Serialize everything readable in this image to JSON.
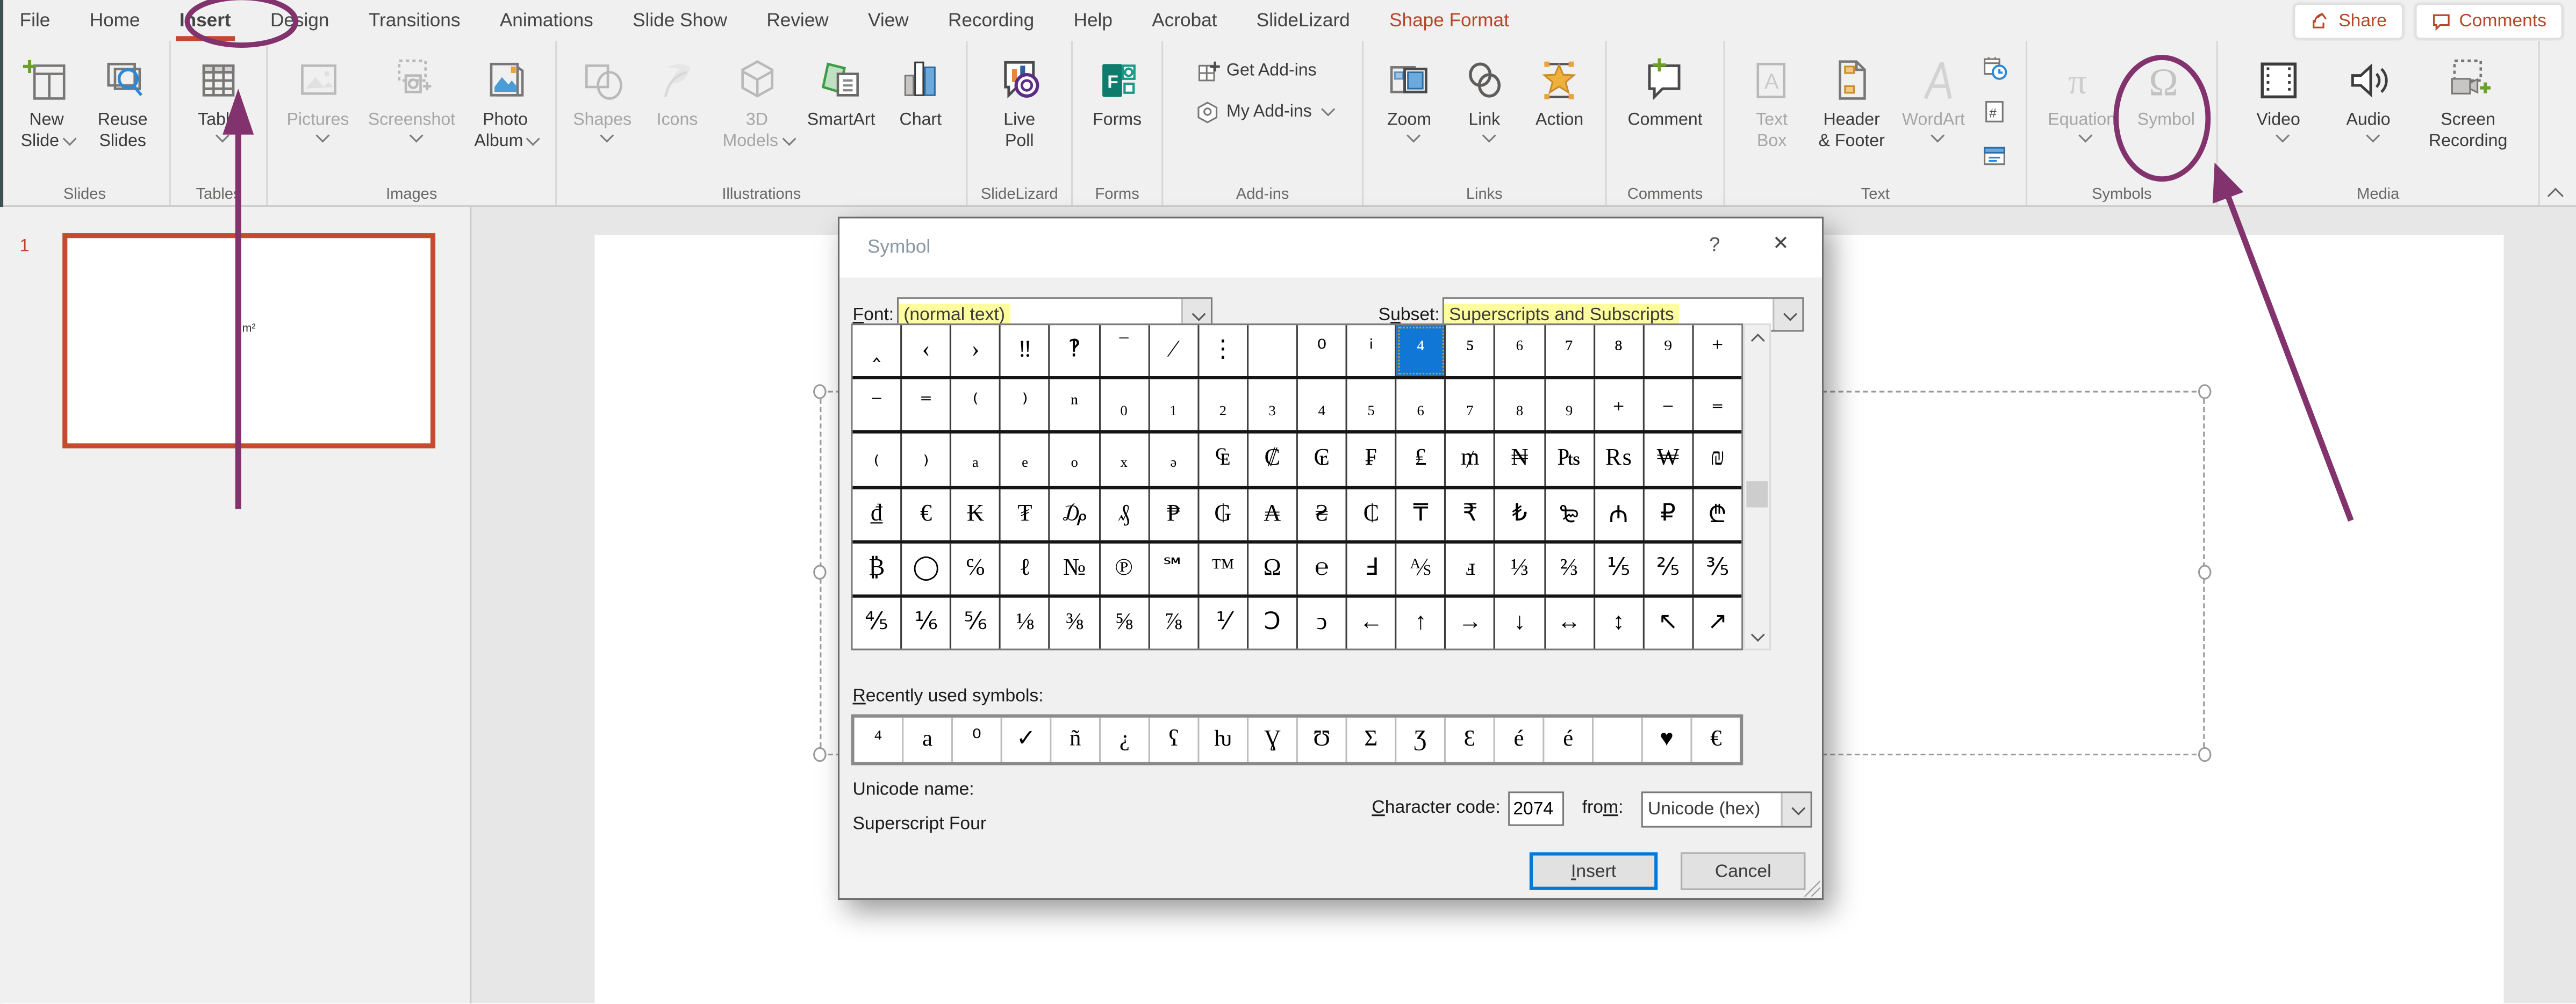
{
  "menu": {
    "tabs": [
      {
        "label": "File"
      },
      {
        "label": "Home"
      },
      {
        "label": "Insert",
        "selected": true
      },
      {
        "label": "Design"
      },
      {
        "label": "Transitions"
      },
      {
        "label": "Animations"
      },
      {
        "label": "Slide Show"
      },
      {
        "label": "Review"
      },
      {
        "label": "View"
      },
      {
        "label": "Recording"
      },
      {
        "label": "Help"
      },
      {
        "label": "Acrobat"
      },
      {
        "label": "SlideLizard"
      },
      {
        "label": "Shape Format",
        "accent": true
      }
    ],
    "share_label": "Share",
    "comments_label": "Comments"
  },
  "ribbon": {
    "groups": [
      {
        "label": "Slides",
        "buttons": [
          {
            "icon": "new-slide",
            "lines": [
              "New",
              "Slide"
            ],
            "chev_inline": true
          },
          {
            "icon": "reuse-slides",
            "lines": [
              "Reuse",
              "Slides"
            ]
          }
        ]
      },
      {
        "label": "Tables",
        "buttons": [
          {
            "icon": "table",
            "lines": [
              "Table"
            ],
            "chev_below": true
          }
        ]
      },
      {
        "label": "Images",
        "buttons": [
          {
            "icon": "pictures",
            "lines": [
              "Pictures"
            ],
            "chev_below": true,
            "disabled": true
          },
          {
            "icon": "screenshot",
            "lines": [
              "Screenshot"
            ],
            "chev_below": true,
            "disabled": true
          },
          {
            "icon": "photo-album",
            "lines": [
              "Photo",
              "Album"
            ],
            "chev_inline": true
          }
        ]
      },
      {
        "label": "Illustrations",
        "buttons": [
          {
            "icon": "shapes",
            "lines": [
              "Shapes"
            ],
            "chev_below": true,
            "disabled": true
          },
          {
            "icon": "icons",
            "lines": [
              "Icons"
            ],
            "disabled": true
          },
          {
            "icon": "3d-models",
            "lines": [
              "3D",
              "Models"
            ],
            "chev_inline": true,
            "disabled": true
          },
          {
            "icon": "smartart",
            "lines": [
              "SmartArt"
            ]
          },
          {
            "icon": "chart",
            "lines": [
              "Chart"
            ]
          }
        ]
      },
      {
        "label": "SlideLizard",
        "buttons": [
          {
            "icon": "live-poll",
            "lines": [
              "Live",
              "Poll"
            ]
          }
        ]
      },
      {
        "label": "Forms",
        "buttons": [
          {
            "icon": "forms",
            "lines": [
              "Forms"
            ]
          }
        ]
      },
      {
        "label": "Add-ins",
        "small_buttons": [
          {
            "icon": "get-addins",
            "label": "Get Add-ins"
          },
          {
            "icon": "my-addins",
            "label": "My Add-ins",
            "chev": true
          }
        ]
      },
      {
        "label": "Links",
        "buttons": [
          {
            "icon": "zoom",
            "lines": [
              "Zoom"
            ],
            "chev_below": true
          },
          {
            "icon": "link",
            "lines": [
              "Link"
            ],
            "chev_below": true
          },
          {
            "icon": "action",
            "lines": [
              "Action"
            ]
          }
        ]
      },
      {
        "label": "Comments",
        "buttons": [
          {
            "icon": "comment",
            "lines": [
              "Comment"
            ]
          }
        ]
      },
      {
        "label": "Text",
        "buttons": [
          {
            "icon": "text-box",
            "lines": [
              "Text",
              "Box"
            ],
            "disabled": true
          },
          {
            "icon": "header-footer",
            "lines": [
              "Header",
              "& Footer"
            ]
          },
          {
            "icon": "wordart",
            "lines": [
              "WordArt"
            ],
            "chev_below": true,
            "disabled": true
          }
        ],
        "stack_icons": [
          "date-time",
          "slide-number",
          "object"
        ]
      },
      {
        "label": "Symbols",
        "buttons": [
          {
            "icon": "equation",
            "lines": [
              "Equation"
            ],
            "chev_below": true,
            "disabled": true
          },
          {
            "icon": "symbol-omega",
            "lines": [
              "Symbol"
            ],
            "disabled": true
          }
        ]
      },
      {
        "label": "Media",
        "buttons": [
          {
            "icon": "video",
            "lines": [
              "Video"
            ],
            "chev_below": true
          },
          {
            "icon": "audio",
            "lines": [
              "Audio"
            ],
            "chev_below": true
          },
          {
            "icon": "screen-recording",
            "lines": [
              "Screen",
              "Recording"
            ]
          }
        ]
      }
    ]
  },
  "slides_panel": {
    "slide_number": "1",
    "slide_text": "m²"
  },
  "dialog": {
    "title": "Symbol",
    "help_icon": "?",
    "close_icon": "✕",
    "font_label": {
      "pre": "",
      "u": "F",
      "post": "ont:"
    },
    "font_value": "(normal text)",
    "subset_label": {
      "pre": "S",
      "u": "u",
      "post": "bset:"
    },
    "subset_value": "Superscripts and Subscripts",
    "grid": {
      "selected": {
        "row": 0,
        "col": 11
      },
      "rows": [
        [
          "‸",
          "‹",
          "›",
          "‼",
          "‽",
          "‾",
          "⁄",
          "⋮",
          "",
          "⁰",
          "ⁱ",
          "⁴",
          "⁵",
          "⁶",
          "⁷",
          "⁸",
          "⁹",
          "⁺"
        ],
        [
          "⁻",
          "⁼",
          "⁽",
          "⁾",
          "ⁿ",
          "₀",
          "₁",
          "₂",
          "₃",
          "₄",
          "₅",
          "₆",
          "₇",
          "₈",
          "₉",
          "₊",
          "₋",
          "₌"
        ],
        [
          "₍",
          "₎",
          "ₐ",
          "ₑ",
          "ₒ",
          "ₓ",
          "ₔ",
          "₠",
          "₡",
          "₢",
          "₣",
          "₤",
          "₥",
          "₦",
          "₧",
          "₨",
          "₩",
          "₪"
        ],
        [
          "₫",
          "€",
          "₭",
          "₮",
          "₯",
          "₰",
          "₱",
          "₲",
          "₳",
          "₴",
          "₵",
          "₸",
          "₹",
          "₺",
          "₻",
          "₼",
          "₽",
          "₾"
        ],
        [
          "₿",
          "◯",
          "℅",
          "ℓ",
          "№",
          "℗",
          "℠",
          "™",
          "Ω",
          "℮",
          "Ⅎ",
          "⅍",
          "ⅎ",
          "⅓",
          "⅔",
          "⅕",
          "⅖",
          "⅗"
        ],
        [
          "⅘",
          "⅙",
          "⅚",
          "⅛",
          "⅜",
          "⅝",
          "⅞",
          "⅟",
          "Ↄ",
          "ↄ",
          "←",
          "↑",
          "→",
          "↓",
          "↔",
          "↕",
          "↖",
          "↗"
        ]
      ]
    },
    "recent_label": {
      "pre": "",
      "u": "R",
      "post": "ecently used symbols:"
    },
    "recent": [
      "⁴",
      "a",
      "⁰",
      "✓",
      "ñ",
      "¿",
      "ʕ",
      "ƕ",
      "Ɣ",
      "Ʊ",
      "Σ",
      "Ʒ",
      "Ɛ",
      "é",
      "é",
      "",
      "♥",
      "€"
    ],
    "unicode_name_label": "Unicode name:",
    "unicode_name": "Superscript Four",
    "char_code_label": {
      "pre": "",
      "u": "C",
      "post": "haracter code:"
    },
    "char_code_value": "2074",
    "from_label": {
      "pre": "fro",
      "u": "m",
      "post": ":"
    },
    "from_value": "Unicode (hex)",
    "insert_label": {
      "pre": "",
      "u": "I",
      "post": "nsert"
    },
    "cancel_label": "Cancel"
  },
  "colors": {
    "accent": "#b7472a",
    "tab_underline": "#c2492d",
    "selection_blue": "#1177d7",
    "highlight_yellow": "#fdfc9e",
    "annotation_purple": "#82336e",
    "slide_border": "#c54b2c"
  }
}
